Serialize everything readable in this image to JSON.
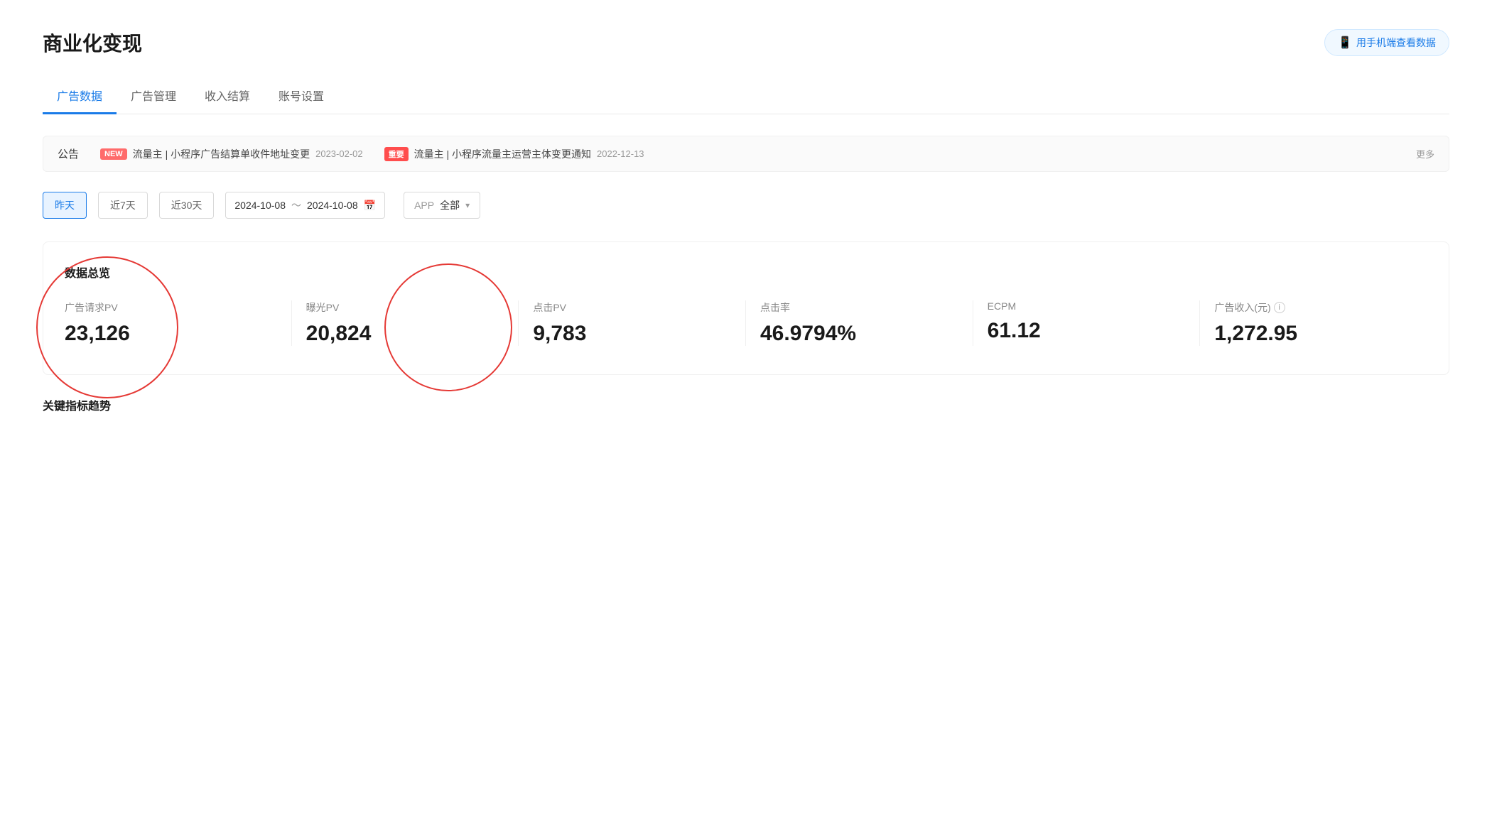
{
  "page": {
    "title": "商业化变现",
    "mobile_btn": "用手机端查看数据"
  },
  "tabs": [
    {
      "id": "ad-data",
      "label": "广告数据",
      "active": true
    },
    {
      "id": "ad-manage",
      "label": "广告管理",
      "active": false
    },
    {
      "id": "income",
      "label": "收入结算",
      "active": false
    },
    {
      "id": "account",
      "label": "账号设置",
      "active": false
    }
  ],
  "notice": {
    "label": "公告",
    "items": [
      {
        "badge": "NEW",
        "badge_type": "new",
        "text": "流量主 | 小程序广告结算单收件地址变更",
        "date": "2023-02-02"
      },
      {
        "badge": "重要",
        "badge_type": "important",
        "text": "流量主 | 小程序流量主运营主体变更通知",
        "date": "2022-12-13"
      }
    ],
    "more": "更多"
  },
  "filter": {
    "time_buttons": [
      {
        "label": "昨天",
        "active": true
      },
      {
        "label": "近7天",
        "active": false
      },
      {
        "label": "近30天",
        "active": false
      }
    ],
    "date_start": "2024-10-08",
    "date_end": "2024-10-08",
    "app_label": "APP",
    "app_value": "全部"
  },
  "stats": {
    "title": "数据总览",
    "items": [
      {
        "id": "ad-request",
        "label": "广告请求PV",
        "value": "23,126",
        "has_info": false
      },
      {
        "id": "exposure",
        "label": "曝光PV",
        "value": "20,824",
        "has_info": false
      },
      {
        "id": "click",
        "label": "点击PV",
        "value": "9,783",
        "has_info": false
      },
      {
        "id": "click-rate",
        "label": "点击率",
        "value": "46.9794%",
        "has_info": false
      },
      {
        "id": "ecpm",
        "label": "ECPM",
        "value": "61.12",
        "has_info": false
      },
      {
        "id": "revenue",
        "label": "广告收入(元)",
        "value": "1,272.95",
        "has_info": true
      }
    ]
  },
  "trend": {
    "title": "关键指标趋势"
  },
  "icons": {
    "mobile": "📱",
    "calendar": "📅",
    "chevron_down": "▾",
    "info": "i"
  }
}
